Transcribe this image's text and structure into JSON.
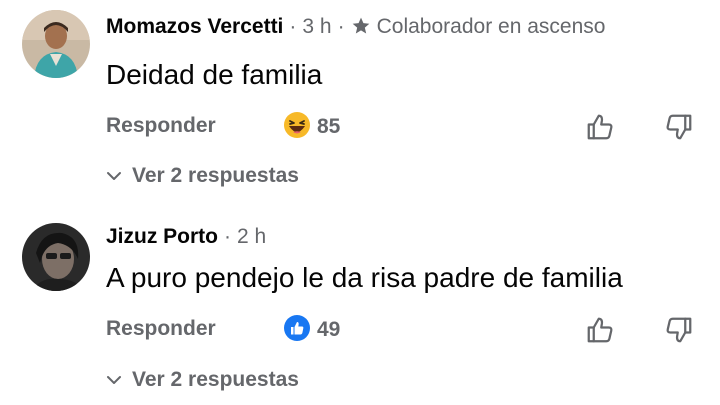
{
  "comments": [
    {
      "author": "Momazos Vercetti",
      "time": "3 h",
      "separator": "·",
      "badge": "Colaborador en ascenso",
      "text": "Deidad de familia",
      "reply_label": "Responder",
      "reaction": {
        "icon": "laughing-emoji-icon",
        "count": "85"
      },
      "replies_label": "Ver 2 respuestas"
    },
    {
      "author": "Jizuz Porto",
      "time": "2 h",
      "separator": "·",
      "text": "A puro pendejo le da risa padre de familia",
      "reply_label": "Responder",
      "reaction": {
        "icon": "like-reaction-icon",
        "count": "49"
      },
      "replies_label": "Ver 2 respuestas"
    }
  ],
  "colors": {
    "text_primary": "#050505",
    "text_secondary": "#65676b",
    "like_blue": "#1877f2",
    "emoji_yellow": "#f7b928"
  }
}
